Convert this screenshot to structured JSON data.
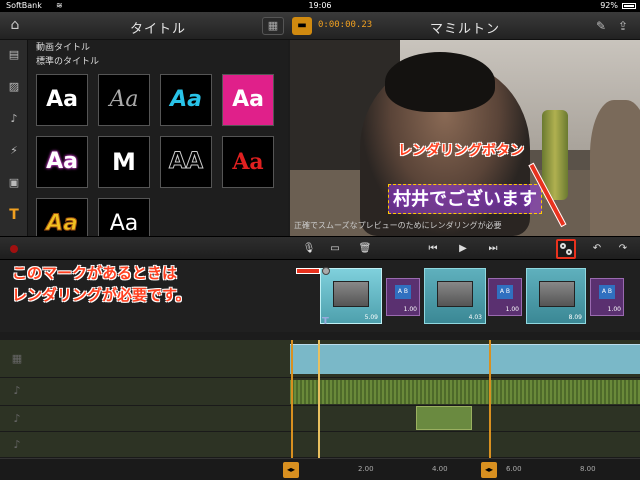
{
  "status_bar": {
    "carrier": "SoftBank",
    "time": "19:06",
    "battery": "92%"
  },
  "header": {
    "left_title": "タイトル",
    "right_title": "マミルトン",
    "timecode": "0:00:00.23"
  },
  "title_panel": {
    "section_motion": "動画タイトル",
    "section_standard": "標準のタイトル",
    "tiles": [
      "Aa",
      "Aa",
      "Aa",
      "Aa",
      "Aa",
      "M",
      "AA",
      "Aa",
      "Aa",
      "Aa"
    ]
  },
  "preview": {
    "caption": "村井でございます",
    "tip": "正確でスムーズなプレビューのためにレンダリングが必要"
  },
  "annotations": {
    "render_button": "レンダリングボタン",
    "mark_line1": "このマークがあるときは",
    "mark_line2": "レンダリングが必要です。"
  },
  "video_track": {
    "clips": [
      {
        "duration": "5.09"
      },
      {
        "duration": "4.03"
      },
      {
        "duration": "8.09"
      }
    ],
    "transitions": [
      {
        "label": "A B",
        "duration": "1.00"
      },
      {
        "label": "A B",
        "duration": "1.00"
      },
      {
        "label": "A B",
        "duration": "1.00"
      }
    ]
  },
  "timeline": {
    "ruler": [
      "2.00",
      "4.00",
      "6.00",
      "8.00"
    ]
  },
  "colors": {
    "accent": "#d89020",
    "annotation": "#ff4020",
    "clip": "#4ea0ad"
  }
}
